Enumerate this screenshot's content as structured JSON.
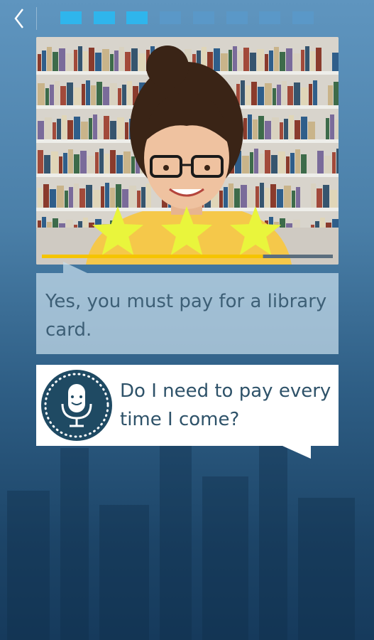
{
  "nav": {
    "back_icon": "chevron-left-icon",
    "progress": {
      "total_steps": 8,
      "completed_steps": 3,
      "completed_color": "#2fb5ec",
      "pending_color": "#5a98c8"
    }
  },
  "video": {
    "scene": "library-bookshelves-woman-with-glasses",
    "stars_earned": 3,
    "stars_total": 3,
    "star_color": "#e9f53c",
    "playback_progress": 0.76,
    "progress_color": "#f5c400"
  },
  "answer": {
    "text": "Yes, you must pay for a library card."
  },
  "question": {
    "mic_icon": "microphone-icon",
    "text": "Do I need to pay every time I come?"
  }
}
